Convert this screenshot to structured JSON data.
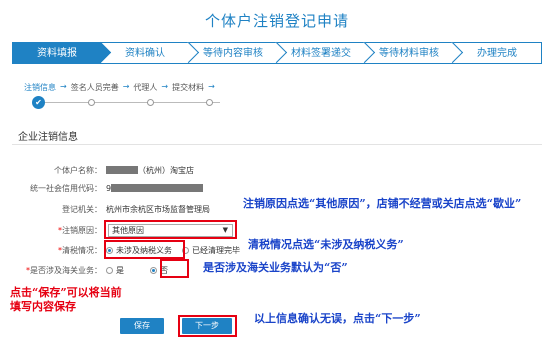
{
  "page": {
    "title": "个体户注销登记申请"
  },
  "steps": [
    "资料填报",
    "资料确认",
    "等待内容审核",
    "材料签署递交",
    "等待材料审核",
    "办理完成"
  ],
  "substeps": {
    "items": [
      "注销信息",
      "签名人员完善",
      "代理人",
      "提交材料"
    ],
    "current": "注销信息",
    "arrow": "→",
    "check": "✔"
  },
  "section_title": "企业注销信息",
  "form": {
    "name_label": "个体户名称：",
    "name_value": "（杭州）淘宝店",
    "code_label": "统一社会信用代码：",
    "code_value": "9",
    "authority_label": "登记机关：",
    "authority_value": "杭州市余杭区市场监督管理局",
    "reason_label": "注销原因：",
    "reason_value": "其他原因",
    "reason_caret": "▼",
    "tax_label": "清税情况：",
    "tax_option1": "未涉及纳税义务",
    "tax_option2": "已经清理完毕",
    "customs_label": "是否涉及海关业务：",
    "customs_yes": "是",
    "customs_no": "否",
    "required_mark": "*"
  },
  "buttons": {
    "save": "保存",
    "next": "下一步"
  },
  "annotations": {
    "reason": "注销原因点选“其他原因”，店铺不经营或关店点选“歇业”",
    "tax": "清税情况点选“未涉及纳税义务”",
    "customs": "是否涉及海关业务默认为“否”",
    "save": "点击“保存”可以将当前填写内容保存",
    "next": "以上信息确认无误，点击“下一步”"
  },
  "colors": {
    "primary": "#1f82c4",
    "annotation_box": "#e60012",
    "annotation_text": "#1a44c9"
  }
}
